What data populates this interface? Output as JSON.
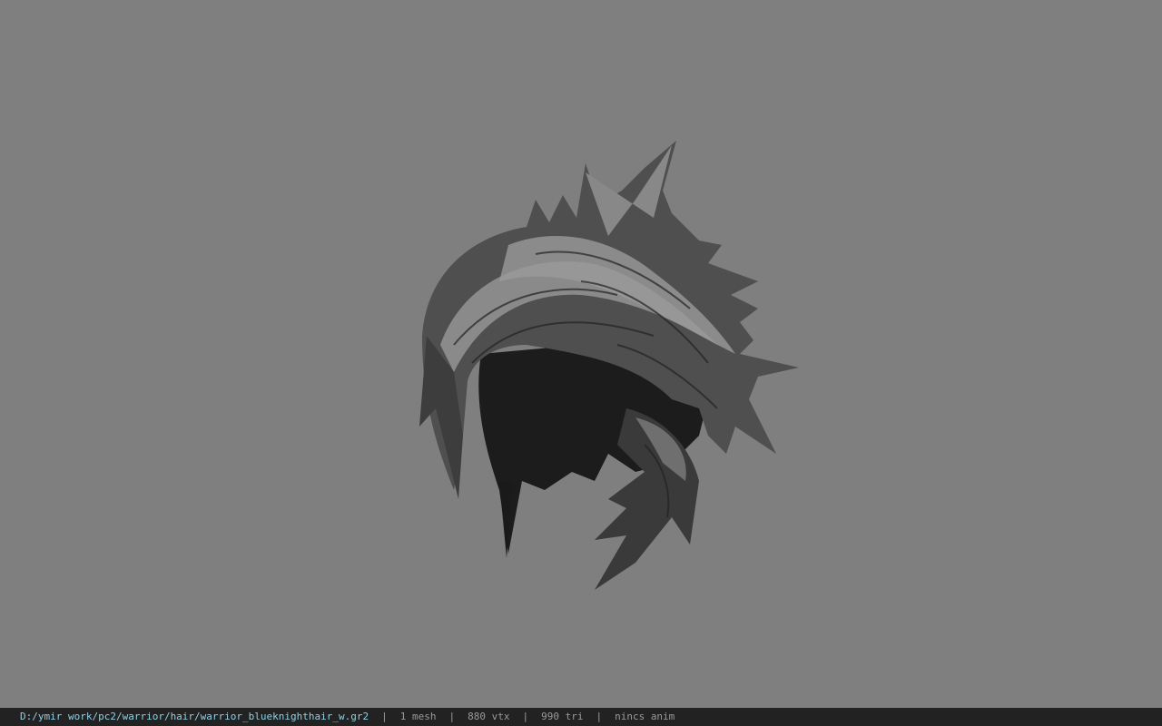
{
  "viewport": {
    "background_color": "#7f7f7f",
    "model_subject": "spiky hair mesh"
  },
  "statusbar": {
    "file_path": "D:/ymir work/pc2/warrior/hair/warrior_blueknighthair_w.gr2",
    "separator": "|",
    "mesh_count": "1 mesh",
    "vertex_count": "880 vtx",
    "triangle_count": "990 tri",
    "anim_status": "nincs anim"
  }
}
